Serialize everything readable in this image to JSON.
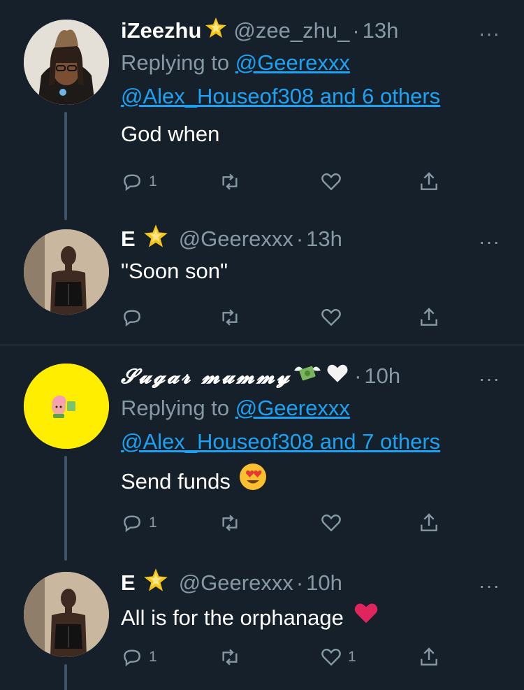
{
  "tweets": [
    {
      "name": "iZeezhu",
      "badge": "star-badge-icon",
      "handle": "@zee_zhu_",
      "dot": "·",
      "time": "13h",
      "more": "···",
      "replying_prefix": "Replying to ",
      "replying_to": "@Geerexxx",
      "replying_others": "@Alex_Houseof308 and 6 others",
      "text": "God when",
      "reply_count": "1",
      "retweet_count": "",
      "like_count": ""
    },
    {
      "name": "E",
      "badge": "star-badge-icon",
      "handle": "@Geerexxx",
      "dot": "·",
      "time": "13h",
      "more": "···",
      "text": "\"Soon son\"",
      "reply_count": "",
      "retweet_count": "",
      "like_count": ""
    },
    {
      "name": "𝓢𝓾𝓰𝓪𝓻 𝓶𝓾𝓶𝓶𝔂",
      "badge": "money-with-wings-icon",
      "handle": "",
      "dot": "·",
      "time": "10h",
      "more": "···",
      "replying_prefix": "Replying to ",
      "replying_to": "@Geerexxx",
      "replying_others": "@Alex_Houseof308 and 7 others",
      "text": "Send funds",
      "reply_count": "1",
      "retweet_count": "",
      "like_count": ""
    },
    {
      "name": "E",
      "badge": "star-badge-icon",
      "handle": "@Geerexxx",
      "dot": "·",
      "time": "10h",
      "more": "···",
      "text": "All is for the orphanage",
      "reply_count": "1",
      "retweet_count": "",
      "like_count": "1"
    }
  ],
  "colors": {
    "background": "#15202b",
    "secondary_text": "#8899a6",
    "link": "#1da1f2",
    "divider": "#38444d",
    "badge_gold": "#f5c518",
    "heart_red": "#e0245e",
    "avatar_yellow": "#ffee00"
  }
}
